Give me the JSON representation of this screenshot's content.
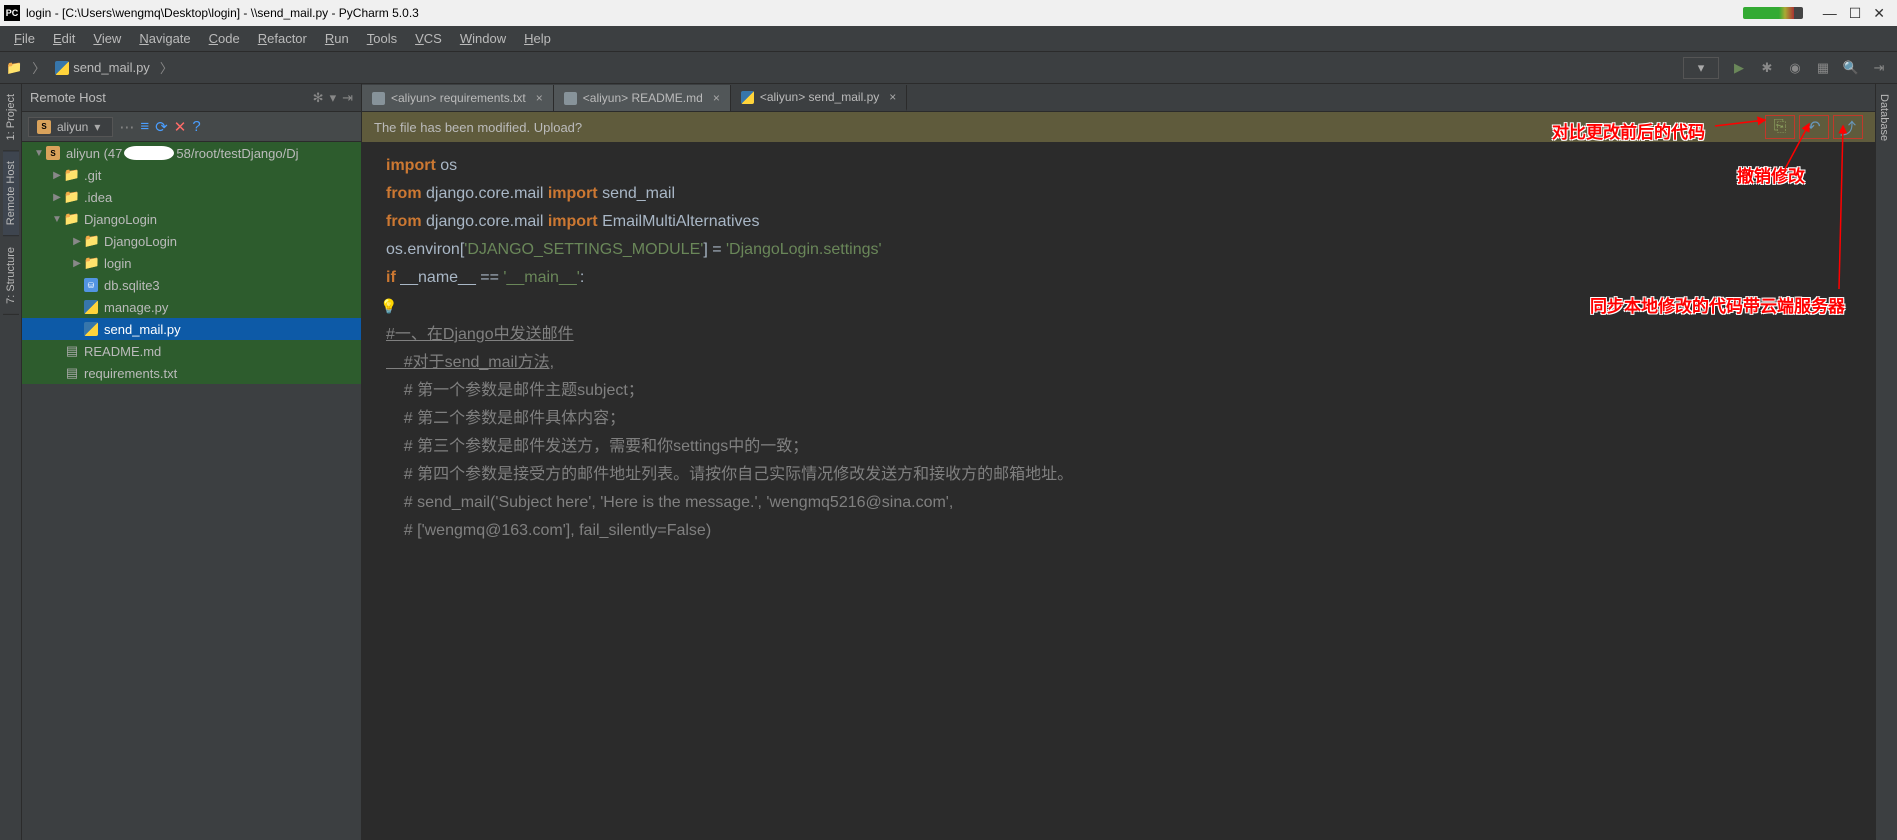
{
  "window": {
    "title": "login - [C:\\Users\\wengmq\\Desktop\\login] - \\\\send_mail.py - PyCharm 5.0.3",
    "app_icon_label": "PC"
  },
  "menu": [
    "File",
    "Edit",
    "View",
    "Navigate",
    "Code",
    "Refactor",
    "Run",
    "Tools",
    "VCS",
    "Window",
    "Help"
  ],
  "breadcrumb": {
    "file": "send_mail.py"
  },
  "sidebar": {
    "title": "Remote Host",
    "server": "aliyun",
    "root_label_pre": "aliyun (47",
    "root_label_post": "58/root/testDjango/Dj",
    "tree": [
      {
        "indent": 1,
        "type": "folder",
        "label": ".git",
        "arrow": "▶"
      },
      {
        "indent": 1,
        "type": "folder",
        "label": ".idea",
        "arrow": "▶"
      },
      {
        "indent": 1,
        "type": "folder",
        "label": "DjangoLogin",
        "arrow": "▼"
      },
      {
        "indent": 2,
        "type": "folder",
        "label": "DjangoLogin",
        "arrow": "▶"
      },
      {
        "indent": 2,
        "type": "folder",
        "label": "login",
        "arrow": "▶"
      },
      {
        "indent": 2,
        "type": "db",
        "label": "db.sqlite3"
      },
      {
        "indent": 2,
        "type": "py",
        "label": "manage.py"
      },
      {
        "indent": 2,
        "type": "py",
        "label": "send_mail.py",
        "selected": true
      },
      {
        "indent": 1,
        "type": "txt",
        "label": "README.md"
      },
      {
        "indent": 1,
        "type": "txt",
        "label": "requirements.txt"
      }
    ]
  },
  "left_tabs": [
    "1: Project",
    "Remote Host",
    "7: Structure"
  ],
  "right_tabs": [
    "Database"
  ],
  "tabs": [
    {
      "icon": "txt",
      "label": "<aliyun> requirements.txt"
    },
    {
      "icon": "txt",
      "label": "<aliyun> README.md"
    },
    {
      "icon": "py",
      "label": "<aliyun> send_mail.py",
      "active": true
    }
  ],
  "notice": "The file has been modified. Upload?",
  "annotations": {
    "diff": "对比更改前后的代码",
    "revert": "撤销修改",
    "upload": "同步本地修改的代码带云端服务器"
  },
  "code_lines": [
    {
      "t": "kw",
      "txt": "import "
    },
    {
      "t": "plain",
      "txt": "os\n"
    },
    {
      "t": "kw",
      "txt": "from "
    },
    {
      "t": "plain",
      "txt": "django.core.mail "
    },
    {
      "t": "kw",
      "txt": "import "
    },
    {
      "t": "plain",
      "txt": "send_mail\n"
    },
    {
      "t": "kw",
      "txt": "from "
    },
    {
      "t": "plain",
      "txt": "django.core.mail "
    },
    {
      "t": "kw",
      "txt": "import "
    },
    {
      "t": "plain",
      "txt": "EmailMultiAlternatives\n"
    },
    {
      "t": "plain",
      "txt": "\n"
    },
    {
      "t": "plain",
      "txt": "os.environ["
    },
    {
      "t": "str",
      "txt": "'DJANGO_SETTINGS_MODULE'"
    },
    {
      "t": "plain",
      "txt": "] = "
    },
    {
      "t": "str",
      "txt": "'DjangoLogin.settings'"
    },
    {
      "t": "plain",
      "txt": "\n"
    },
    {
      "t": "kw",
      "txt": "if "
    },
    {
      "t": "plain",
      "txt": "__name__ == "
    },
    {
      "t": "str",
      "txt": "'__main__'"
    },
    {
      "t": "plain",
      "txt": ":\n"
    },
    {
      "t": "bulb",
      "txt": "💡\n"
    },
    {
      "t": "cmund",
      "txt": "#一、在Django中发送邮件"
    },
    {
      "t": "plain",
      "txt": "\n"
    },
    {
      "t": "cmund",
      "txt": "    #对于send_mail方法,"
    },
    {
      "t": "plain",
      "txt": "\n"
    },
    {
      "t": "cm",
      "txt": "    # 第一个参数是邮件主题subject；\n"
    },
    {
      "t": "cm",
      "txt": "    # 第二个参数是邮件具体内容；\n"
    },
    {
      "t": "cm",
      "txt": "    # 第三个参数是邮件发送方，需要和你settings中的一致；\n"
    },
    {
      "t": "cm",
      "txt": "    # 第四个参数是接受方的邮件地址列表。请按你自己实际情况修改发送方和接收方的邮箱地址。\n"
    },
    {
      "t": "plain",
      "txt": "\n"
    },
    {
      "t": "cm",
      "txt": "    # send_mail('Subject here', 'Here is the message.', 'wengmq5216@sina.com',\n"
    },
    {
      "t": "cm",
      "txt": "    # ['wengmq@163.com'], fail_silently=False)\n"
    }
  ]
}
